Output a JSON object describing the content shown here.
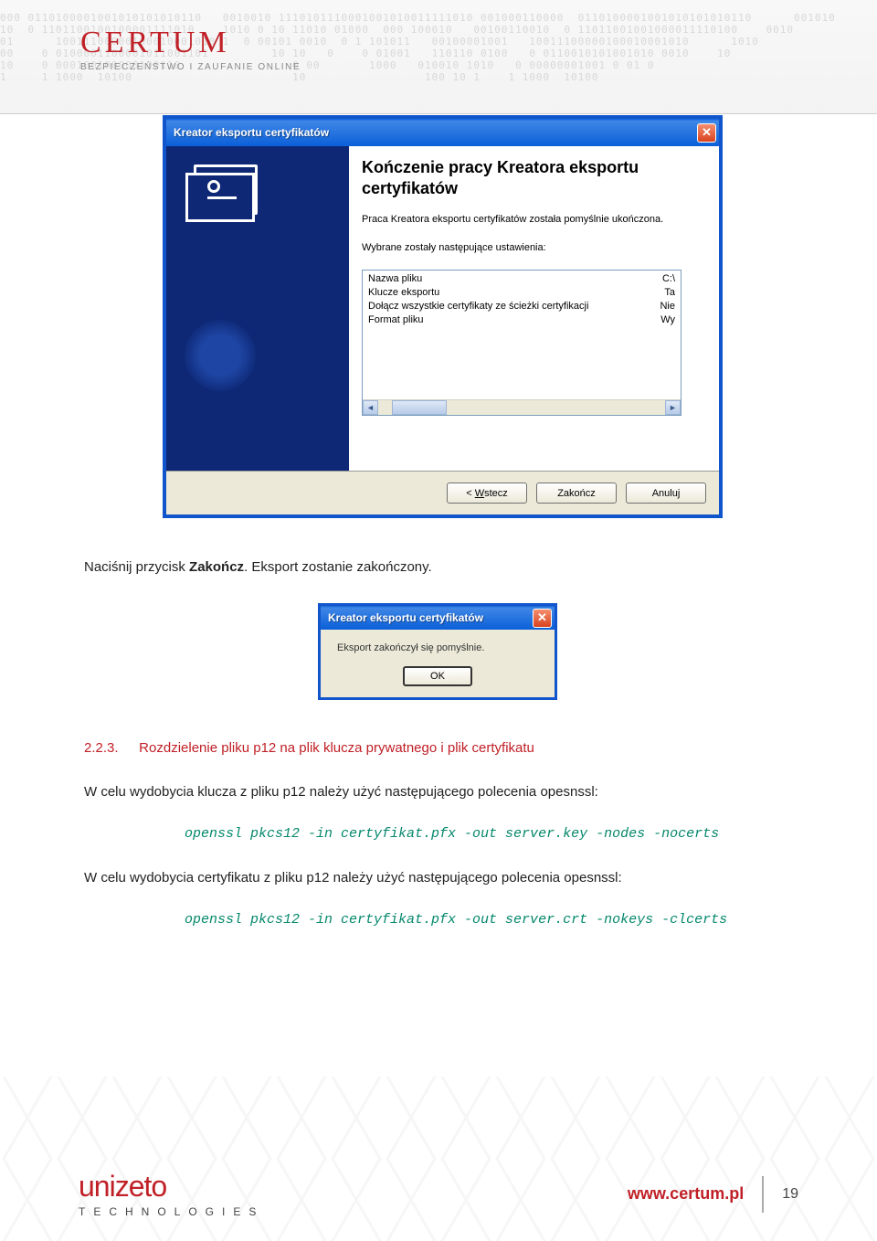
{
  "header": {
    "brand": "CERTUM",
    "tagline": "BEZPIECZEŃSTWO I ZAUFANIE ONLINE"
  },
  "wizard": {
    "title": "Kreator eksportu certyfikatów",
    "heading": "Kończenie pracy Kreatora eksportu certyfikatów",
    "done_text": "Praca Kreatora eksportu certyfikatów została pomyślnie ukończona.",
    "settings_label": "Wybrane zostały następujące ustawienia:",
    "rows": [
      {
        "k": "Nazwa pliku",
        "v": "C:\\"
      },
      {
        "k": "Klucze eksportu",
        "v": "Ta"
      },
      {
        "k": "Dołącz wszystkie certyfikaty ze ścieżki certyfikacji",
        "v": "Nie"
      },
      {
        "k": "Format pliku",
        "v": "Wy"
      }
    ],
    "buttons": {
      "back_pre": "< ",
      "back_ul": "W",
      "back_post": "stecz",
      "finish": "Zakończ",
      "cancel": "Anuluj"
    }
  },
  "caption": {
    "pre": "Naciśnij przycisk ",
    "bold": "Zakończ",
    "post": ". Eksport zostanie zakończony."
  },
  "msgbox": {
    "title": "Kreator eksportu certyfikatów",
    "text": "Eksport zakończył się pomyślnie.",
    "ok": "OK"
  },
  "section": {
    "num": "2.2.3.",
    "title": "Rozdzielenie pliku p12 na plik klucza prywatnego i plik certyfikatu"
  },
  "p1": "W celu wydobycia klucza z pliku p12 należy użyć następującego polecenia opesnssl:",
  "code1": "openssl pkcs12 -in certyfikat.pfx -out server.key -nodes -nocerts",
  "p2": "W celu wydobycia certyfikatu z pliku p12 należy użyć następującego polecenia opesnssl:",
  "code2": "openssl pkcs12 -in certyfikat.pfx -out server.crt -nokeys -clcerts",
  "footer": {
    "brand": "unizeto",
    "tag": "TECHNOLOGIES",
    "url": "www.certum.pl",
    "page": "19"
  }
}
